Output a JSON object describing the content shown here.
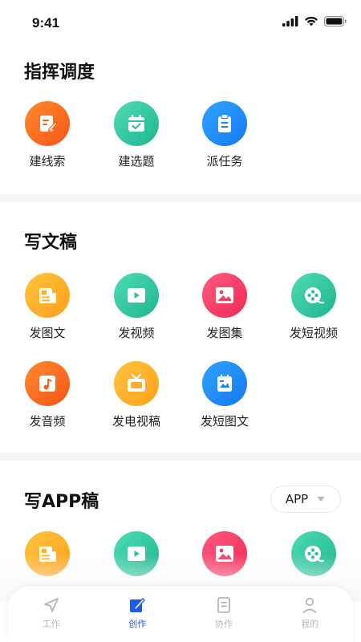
{
  "status": {
    "time": "9:41"
  },
  "section1": {
    "title": "指挥调度",
    "items": [
      {
        "label": "建线索",
        "icon": "edit-note-icon",
        "color": "orange"
      },
      {
        "label": "建选题",
        "icon": "calendar-check-icon",
        "color": "teal"
      },
      {
        "label": "派任务",
        "icon": "clipboard-icon",
        "color": "blue"
      }
    ]
  },
  "section2": {
    "title": "写文稿",
    "items": [
      {
        "label": "发图文",
        "icon": "newspaper-icon",
        "color": "yellow"
      },
      {
        "label": "发视频",
        "icon": "play-icon",
        "color": "teal"
      },
      {
        "label": "发图集",
        "icon": "image-icon",
        "color": "pink"
      },
      {
        "label": "发短视频",
        "icon": "film-reel-icon",
        "color": "teal"
      },
      {
        "label": "发音频",
        "icon": "music-note-icon",
        "color": "orange"
      },
      {
        "label": "发电视稿",
        "icon": "tv-icon",
        "color": "yellow"
      },
      {
        "label": "发短图文",
        "icon": "short-article-icon",
        "color": "blue"
      }
    ]
  },
  "section3": {
    "title": "写APP稿",
    "selector": "APP",
    "items": [
      {
        "icon": "newspaper-icon",
        "color": "yellow"
      },
      {
        "icon": "play-icon",
        "color": "teal"
      },
      {
        "icon": "image-icon",
        "color": "pink"
      },
      {
        "icon": "film-reel-icon",
        "color": "teal"
      }
    ]
  },
  "tabbar": {
    "tabs": [
      {
        "label": "工作",
        "icon": "send-icon",
        "active": false
      },
      {
        "label": "创作",
        "icon": "compose-icon",
        "active": true
      },
      {
        "label": "协作",
        "icon": "document-icon",
        "active": false
      },
      {
        "label": "我的",
        "icon": "user-icon",
        "active": false
      }
    ]
  },
  "colors": {
    "active_tab": "#1d5be8",
    "inactive_tab": "#b3b6bd",
    "divider": "#f4f5f7"
  }
}
